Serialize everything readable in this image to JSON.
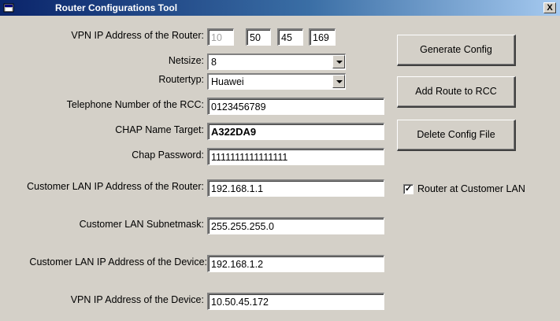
{
  "window": {
    "title": "Router Configurations Tool",
    "close_glyph": "X"
  },
  "labels": {
    "vpn_router": "VPN IP Address of the Router:",
    "netsize": "Netsize:",
    "routertyp": "Routertyp:",
    "telephone": "Telephone Number of the RCC:",
    "chap_name": "CHAP Name Target:",
    "chap_password": "Chap Password:",
    "lan_ip_router": "Customer LAN IP Address of the Router:",
    "lan_subnet": "Customer LAN Subnetmask:",
    "lan_ip_device": "Customer LAN IP Address of the Device:",
    "vpn_device": "VPN IP Address of the Device:"
  },
  "fields": {
    "vpn_router_octets": [
      "10",
      "50",
      "45",
      "169"
    ],
    "netsize": "8",
    "routertyp": "Huawei",
    "telephone": "0123456789",
    "chap_name": "A322DA9",
    "chap_password": "1111111111111111",
    "lan_ip_router": "192.168.1.1",
    "lan_subnet": "255.255.255.0",
    "lan_ip_device": "192.168.1.2",
    "vpn_device": "10.50.45.172"
  },
  "buttons": {
    "generate": "Generate Config",
    "add_route": "Add Route to RCC",
    "delete": "Delete Config File"
  },
  "checkbox": {
    "label": "Router at Customer LAN",
    "checked": true,
    "mark": "✓"
  }
}
